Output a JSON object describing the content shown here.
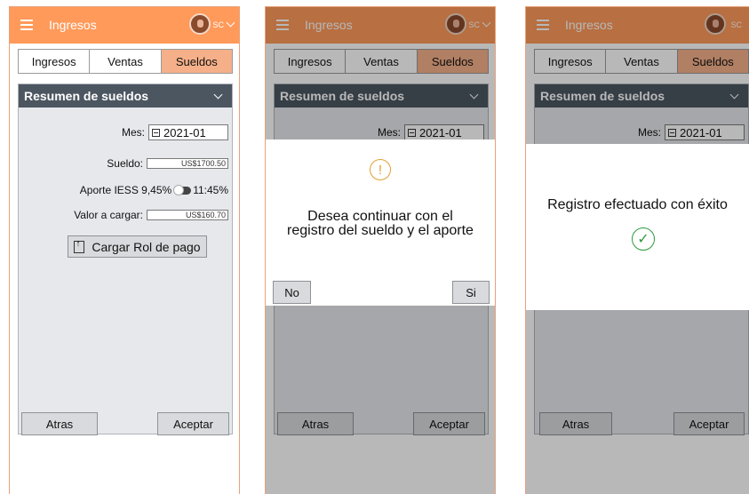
{
  "header": {
    "title": "Ingresos",
    "user_initials": "SC"
  },
  "tabs": [
    "Ingresos",
    "Ventas",
    "Sueldos"
  ],
  "panel": {
    "title": "Resumen de sueldos",
    "mes_label": "Mes:",
    "mes_value": "2021-01",
    "sueldo_label": "Sueldo:",
    "sueldo_value": "US$1700.50",
    "aporte_label": "Aporte IESS 9,45%",
    "aporte_alt": "11:45%",
    "valor_label": "Valor a cargar:",
    "valor_value": "US$160.70",
    "upload_label": "Cargar Rol de pago"
  },
  "footer": {
    "back": "Atras",
    "accept": "Aceptar"
  },
  "confirm_dialog": {
    "line1": "Desea continuar con el",
    "line2": "registro del sueldo y el aporte",
    "no": "No",
    "yes": "Si"
  },
  "success_dialog": {
    "message": "Registro efectuado con éxito"
  },
  "colors": {
    "accent": "#ff9a5a",
    "panel_head": "#4c5661",
    "active_tab": "#f5b089"
  }
}
